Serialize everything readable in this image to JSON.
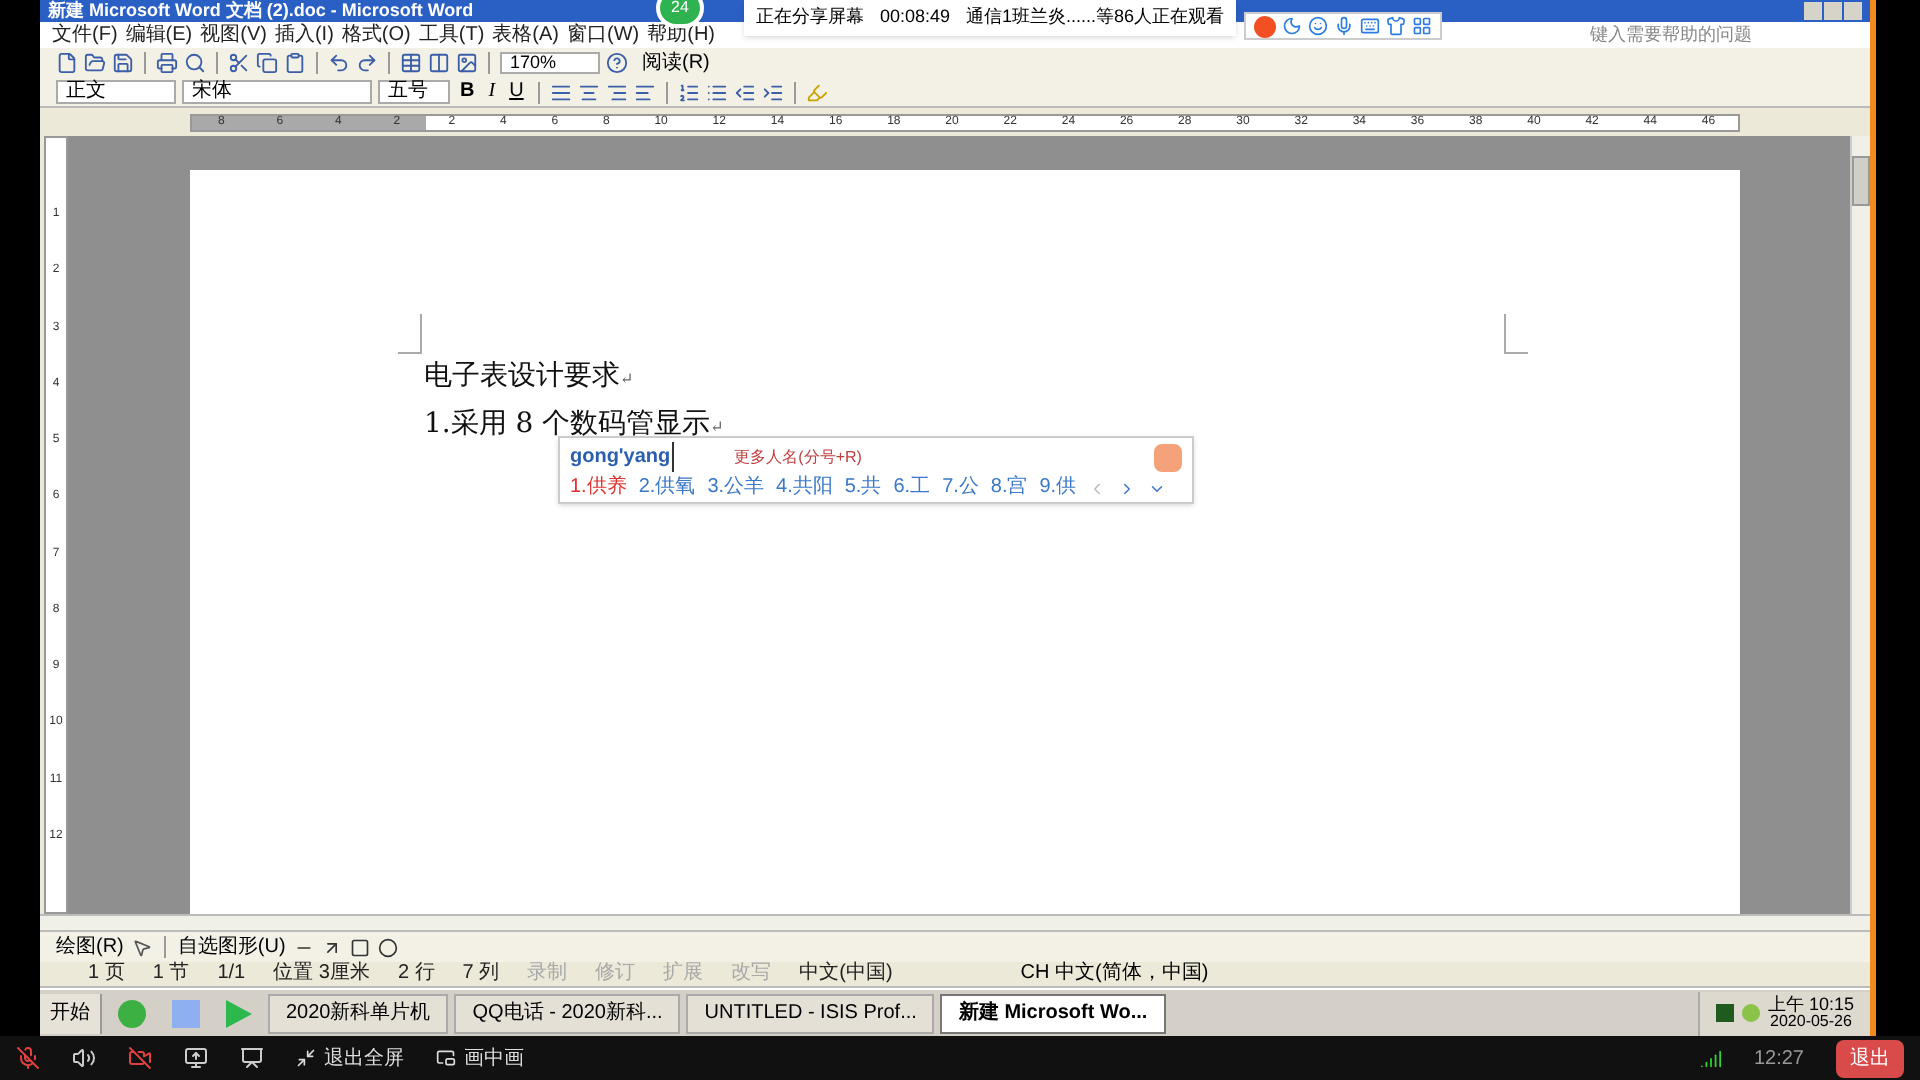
{
  "meeting_banner": {
    "badge": "24",
    "sharing": "正在分享屏幕",
    "timer": "00:08:49",
    "viewers": "通信1班兰炎......等86人正在观看"
  },
  "window": {
    "title": "新建 Microsoft Word 文档 (2).doc - Microsoft Word"
  },
  "menu": [
    "文件(F)",
    "编辑(E)",
    "视图(V)",
    "插入(I)",
    "格式(O)",
    "工具(T)",
    "表格(A)",
    "窗口(W)",
    "帮助(H)"
  ],
  "help_search": {
    "placeholder": "键入需要帮助的问题"
  },
  "standard_toolbar": {
    "zoom": "170%",
    "read": "阅读(R)"
  },
  "format_toolbar": {
    "style": "正文",
    "font": "宋体",
    "size": "五号",
    "bold": "B",
    "italic": "I",
    "underline": "U"
  },
  "ruler": {
    "left_labels": [
      "8",
      "6",
      "4",
      "2"
    ],
    "labels": [
      "2",
      "4",
      "6",
      "8",
      "10",
      "12",
      "14",
      "16",
      "18",
      "20",
      "22",
      "24",
      "26",
      "28",
      "30",
      "32",
      "34",
      "36",
      "38",
      "40",
      "42",
      "44",
      "46"
    ]
  },
  "vertical_ruler": {
    "labels": [
      "1",
      "2",
      "3",
      "4",
      "5",
      "6",
      "7",
      "8",
      "9",
      "10",
      "11",
      "12"
    ]
  },
  "document": {
    "paragraphs": [
      "电子表设计要求",
      "1.采用 8 个数码管显示"
    ],
    "paragraph_mark": "↵"
  },
  "ime": {
    "input": "gong'yang",
    "hint": "更多人名(分号+R)",
    "candidates": [
      {
        "text": "1.供养",
        "selected": true
      },
      {
        "text": "2.供氧",
        "selected": false
      },
      {
        "text": "3.公羊",
        "selected": false
      },
      {
        "text": "4.共阳",
        "selected": false
      },
      {
        "text": "5.共",
        "selected": false
      },
      {
        "text": "6.工",
        "selected": false
      },
      {
        "text": "7.公",
        "selected": false
      },
      {
        "text": "8.宫",
        "selected": false
      },
      {
        "text": "9.供",
        "selected": false
      }
    ]
  },
  "drawing_toolbar": {
    "draw": "绘图(R)",
    "autoshapes": "自选图形(U)"
  },
  "status_bar": [
    {
      "text": "1 页",
      "disabled": false
    },
    {
      "text": "1 节",
      "disabled": false
    },
    {
      "text": "1/1",
      "disabled": false
    },
    {
      "text": "位置 3厘米",
      "disabled": false
    },
    {
      "text": "2 行",
      "disabled": false
    },
    {
      "text": "7 列",
      "disabled": false
    },
    {
      "text": "录制",
      "disabled": true
    },
    {
      "text": "修订",
      "disabled": true
    },
    {
      "text": "扩展",
      "disabled": true
    },
    {
      "text": "改写",
      "disabled": true
    },
    {
      "text": "中文(中国)",
      "disabled": false
    }
  ],
  "language_bar": "CH 中文(简体，中国)",
  "taskbar": {
    "start": "开始",
    "tasks": [
      {
        "label": "2020新科单片机",
        "selected": false
      },
      {
        "label": "QQ电话 - 2020新科...",
        "selected": false
      },
      {
        "label": "UNTITLED - ISIS Prof...",
        "selected": false
      },
      {
        "label": "新建 Microsoft Wo...",
        "selected": true
      }
    ],
    "clock_time": "上午 10:15",
    "clock_date": "2020-05-26"
  },
  "meeting_bar": {
    "exit_fullscreen": "退出全屏",
    "pip": "画中画",
    "time": "12:27",
    "leave": "退出"
  }
}
